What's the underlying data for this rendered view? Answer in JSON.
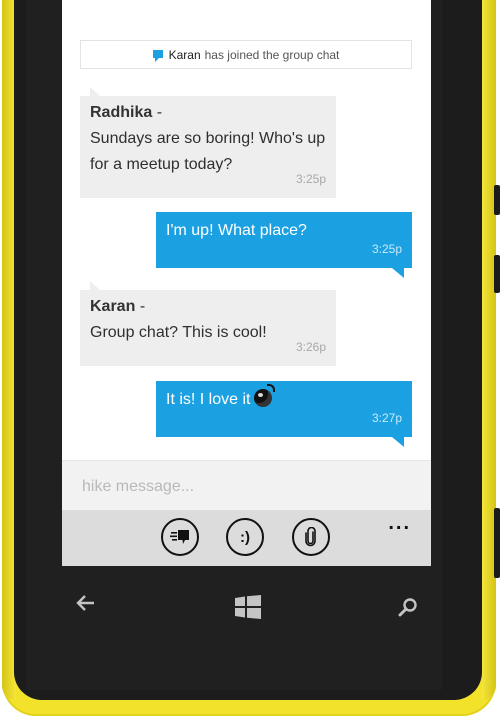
{
  "system_message": {
    "name": "Karan",
    "text": "has joined the group chat"
  },
  "messages": [
    {
      "type": "received",
      "sender": "Radhika",
      "separator": "-",
      "lines": [
        "Sundays are so boring! Who's up",
        "for a meetup today?"
      ],
      "time": "3:25p"
    },
    {
      "type": "sent",
      "text": "I'm up! What place?",
      "time": "3:25p"
    },
    {
      "type": "received",
      "sender": "Karan",
      "separator": "-",
      "lines": [
        "Group chat? This is cool!"
      ],
      "time": "3:26p"
    },
    {
      "type": "sent",
      "text": "It is! I love it",
      "time": "3:27p",
      "emoji": "bomb-icon"
    }
  ],
  "composer": {
    "placeholder": "hike message..."
  },
  "appbar": {
    "buttons": [
      "quick-replies-icon",
      "emoticons-icon",
      "attachment-icon"
    ],
    "emoticon_glyph": ":)",
    "more": "..."
  },
  "hardware_keys": [
    "back-icon",
    "windows-start-icon",
    "search-icon"
  ],
  "colors": {
    "accent": "#1ba1e2",
    "received_bubble": "#eeeeee",
    "phone_body": "#f2e22a"
  }
}
